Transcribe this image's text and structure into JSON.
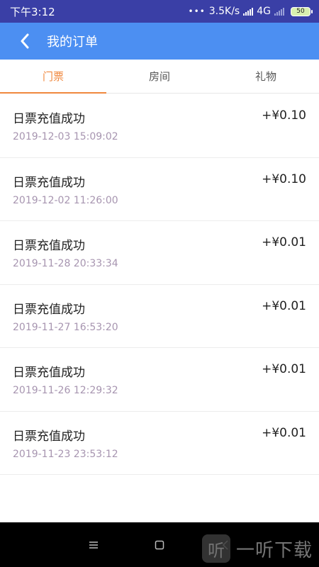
{
  "status_bar": {
    "time": "下午3:12",
    "dots": "•••",
    "speed": "3.5K/s",
    "network": "4G",
    "battery": "50"
  },
  "app_bar": {
    "back_icon": "chevron-left-icon",
    "title": "我的订单"
  },
  "tabs": [
    {
      "label": "门票",
      "active": true
    },
    {
      "label": "房间",
      "active": false
    },
    {
      "label": "礼物",
      "active": false
    }
  ],
  "orders": [
    {
      "title": "日票充值成功",
      "time": "2019-12-03 15:09:02",
      "amount": "+¥0.10"
    },
    {
      "title": "日票充值成功",
      "time": "2019-12-02 11:26:00",
      "amount": "+¥0.10"
    },
    {
      "title": "日票充值成功",
      "time": "2019-11-28 20:33:34",
      "amount": "+¥0.01"
    },
    {
      "title": "日票充值成功",
      "time": "2019-11-27 16:53:20",
      "amount": "+¥0.01"
    },
    {
      "title": "日票充值成功",
      "time": "2019-11-26 12:29:32",
      "amount": "+¥0.01"
    },
    {
      "title": "日票充值成功",
      "time": "2019-11-23 23:53:12",
      "amount": "+¥0.01"
    }
  ],
  "nav_bar": {
    "menu_icon": "menu-icon",
    "home_icon": "home-square-icon",
    "back_icon": "back-icon"
  },
  "watermark": {
    "logo_glyph": "听",
    "text": "一听下载"
  },
  "colors": {
    "status_bar": "#3a3fa6",
    "app_bar": "#4c8ff2",
    "accent": "#f0883e",
    "timestamp": "#a795b0"
  }
}
